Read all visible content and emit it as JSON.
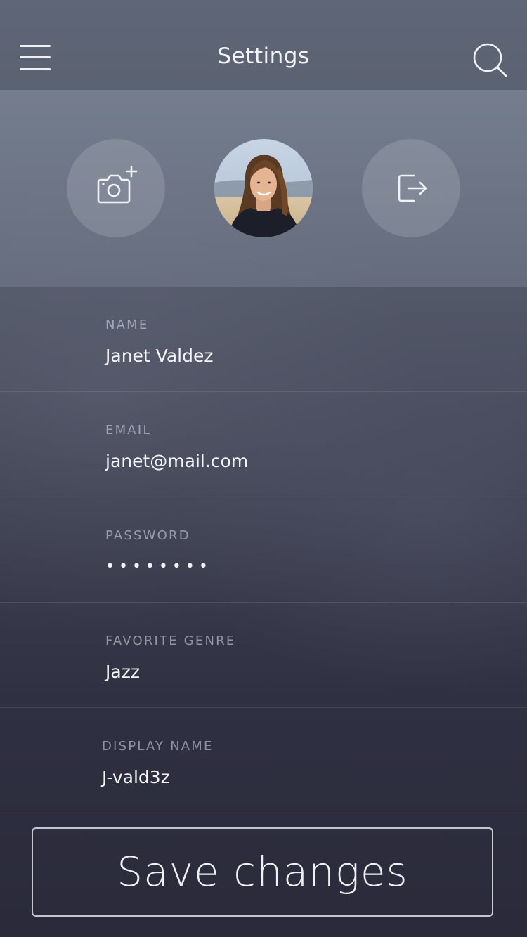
{
  "header": {
    "title": "Settings",
    "menu_icon": "hamburger-menu-icon",
    "search_icon": "search-icon"
  },
  "profile": {
    "add_photo_icon": "camera-plus-icon",
    "avatar": "profile-photo",
    "logout_icon": "logout-icon"
  },
  "form": {
    "fields": [
      {
        "label": "NAME",
        "value": "Janet Valdez"
      },
      {
        "label": "EMAIL",
        "value": "janet@mail.com"
      },
      {
        "label": "PASSWORD",
        "value": "••••••••"
      },
      {
        "label": "FAVORITE GENRE",
        "value": "Jazz"
      },
      {
        "label": "DISPLAY NAME",
        "value": "J-vald3z"
      }
    ]
  },
  "actions": {
    "save_label": "Save changes"
  },
  "colors": {
    "text_primary": "#f4f5f8",
    "text_label": "#a9adb9",
    "band": "#7f889a",
    "background_bottom": "#2a2a3a"
  }
}
